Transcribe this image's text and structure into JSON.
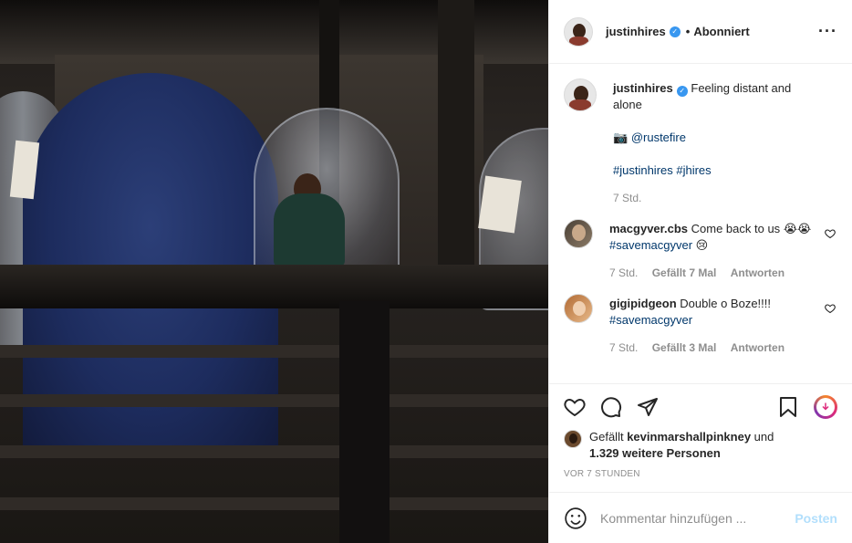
{
  "header": {
    "username": "justinhires",
    "separator": "•",
    "follow_status": "Abonniert",
    "more_icon": "more-horizontal-icon"
  },
  "caption": {
    "username": "justinhires",
    "text": "Feeling distant and alone",
    "camera_emoji": "📷",
    "credit": "@rustefire",
    "hashtags": "#justinhires #jhires",
    "time": "7 Std."
  },
  "comments": [
    {
      "username": "macgyver.cbs",
      "text": "Come back to us",
      "emoji_before": "😭😭",
      "hashtag": "#savemacgyver",
      "emoji_after": "😢",
      "time": "7 Std.",
      "likes": "Gefällt 7 Mal",
      "reply": "Antworten"
    },
    {
      "username": "gigipidgeon",
      "text": "Double o Boze!!!!",
      "hashtag": "#savemacgyver",
      "time": "7 Std.",
      "likes": "Gefällt 3 Mal",
      "reply": "Antworten"
    }
  ],
  "likes": {
    "prefix": "Gefällt",
    "user": "kevinmarshallpinkney",
    "connector": "und",
    "others": "1.329 weitere Personen"
  },
  "post_age": "VOR 7 STUNDEN",
  "add_comment": {
    "placeholder": "Kommentar hinzufügen ...",
    "post_label": "Posten"
  },
  "colors": {
    "link": "#00376b",
    "verified": "#3897f0",
    "muted": "#8e8e8e",
    "post_disabled": "#b2dffc"
  }
}
